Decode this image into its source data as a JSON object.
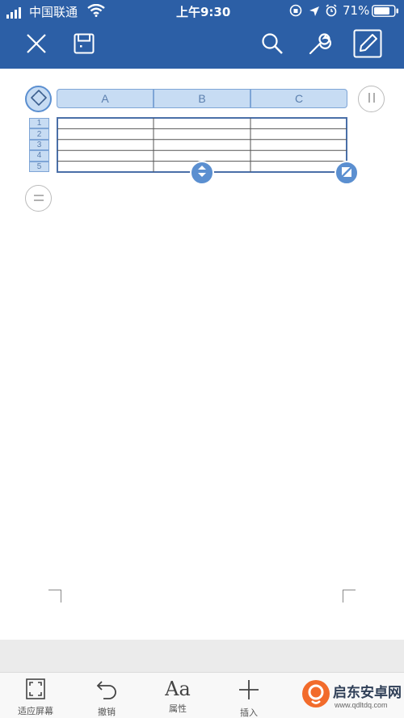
{
  "status_bar": {
    "carrier": "中国联通",
    "time": "上午9:30",
    "battery_percent": "71%"
  },
  "toolbar": {
    "close_icon": "close-icon",
    "save_icon": "save-icon",
    "search_icon": "search-icon",
    "tools_icon": "wrench-icon",
    "edit_icon": "pencil-icon"
  },
  "table": {
    "columns": [
      "A",
      "B",
      "C"
    ],
    "rows": [
      "1",
      "2",
      "3",
      "4",
      "5"
    ]
  },
  "bottom_bar": {
    "items": [
      {
        "label": "适应屏幕",
        "icon": "fit-screen-icon"
      },
      {
        "label": "撤销",
        "icon": "undo-icon"
      },
      {
        "label": "属性",
        "icon": "font-properties-icon"
      },
      {
        "label": "插入",
        "icon": "plus-icon"
      }
    ]
  },
  "watermark": {
    "text": "启东安卓网",
    "url": "www.qdltdq.com"
  },
  "colors": {
    "toolbar_bg": "#2c5fa6",
    "header_fill": "#c7dcf3",
    "table_border": "#4a6fa8",
    "handle_blue": "#5b8fd0"
  }
}
